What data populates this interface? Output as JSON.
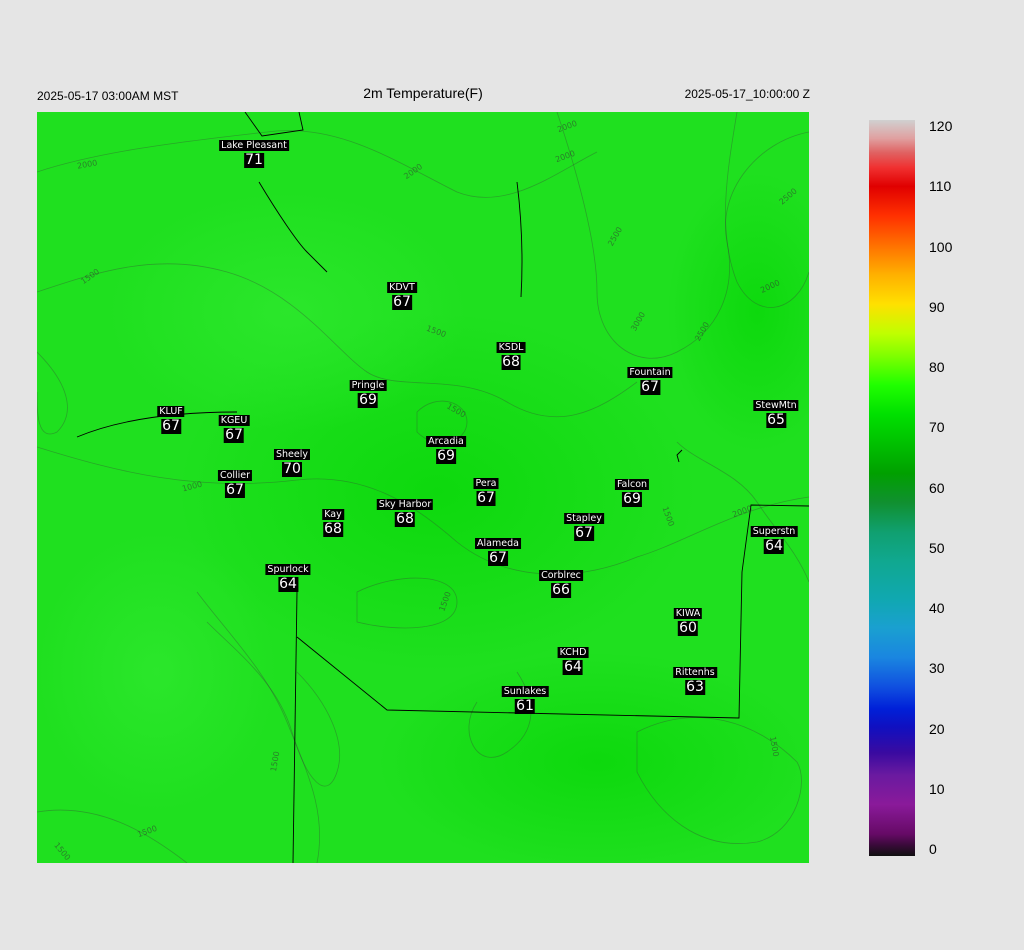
{
  "header": {
    "title": "2m Temperature(F)",
    "local_time": "2025-05-17 03:00AM MST",
    "utc_time": "2025-05-17_10:00:00 Z"
  },
  "colors": {
    "background": "#e5e5e5",
    "map_fill": "#1ad01a",
    "label_bg": "#000000"
  },
  "stations": [
    {
      "name": "Lake Pleasant",
      "value": "71"
    },
    {
      "name": "KDVT",
      "value": "67"
    },
    {
      "name": "KSDL",
      "value": "68"
    },
    {
      "name": "Pringle",
      "value": "69"
    },
    {
      "name": "Fountain",
      "value": "67"
    },
    {
      "name": "KLUF",
      "value": "67"
    },
    {
      "name": "KGEU",
      "value": "67"
    },
    {
      "name": "StewMtn",
      "value": "65"
    },
    {
      "name": "Arcadia",
      "value": "69"
    },
    {
      "name": "Sheely",
      "value": "70"
    },
    {
      "name": "Collier",
      "value": "67"
    },
    {
      "name": "Pera",
      "value": "67"
    },
    {
      "name": "Falcon",
      "value": "69"
    },
    {
      "name": "Kay",
      "value": "68"
    },
    {
      "name": "Sky Harbor",
      "value": "68"
    },
    {
      "name": "Stapley",
      "value": "67"
    },
    {
      "name": "Superstn",
      "value": "64"
    },
    {
      "name": "Alameda",
      "value": "67"
    },
    {
      "name": "Spurlock",
      "value": "64"
    },
    {
      "name": "Corblrec",
      "value": "66"
    },
    {
      "name": "KIWA",
      "value": "60"
    },
    {
      "name": "KCHD",
      "value": "64"
    },
    {
      "name": "Rittenhs",
      "value": "63"
    },
    {
      "name": "Sunlakes",
      "value": "61"
    }
  ],
  "contour_labels": [
    "2000",
    "2000",
    "2000",
    "2500",
    "1500",
    "1500",
    "2500",
    "2000",
    "3000",
    "2500",
    "1500",
    "1500",
    "1000",
    "1500",
    "2000",
    "1500",
    "1500",
    "1500",
    "1500",
    "2000"
  ],
  "colorbar": {
    "ticks": [
      "120",
      "110",
      "100",
      "90",
      "80",
      "70",
      "60",
      "50",
      "40",
      "30",
      "20",
      "10",
      "0"
    ]
  }
}
